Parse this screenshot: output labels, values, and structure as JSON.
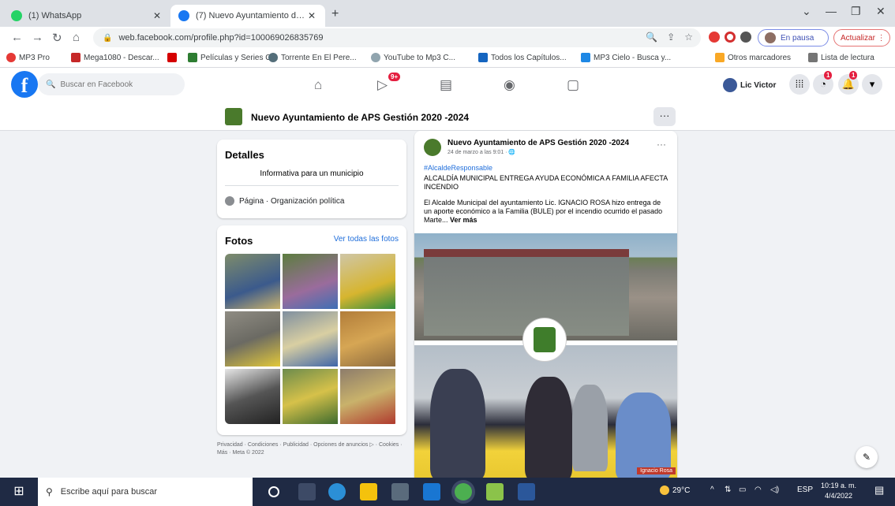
{
  "browser": {
    "tabs": [
      {
        "title": "(1) WhatsApp",
        "active": false
      },
      {
        "title": "(7) Nuevo Ayuntamiento de APS",
        "active": true
      }
    ],
    "address": "web.facebook.com/profile.php?id=100069026835769",
    "profile_pill": "En pausa",
    "update_pill": "Actualizar",
    "bookmarks": [
      "MP3 Pro",
      "Mega1080 - Descar...",
      "",
      "Películas y Series O...",
      "Torrente En El Pere...",
      "YouTube to Mp3 C...",
      "Todos los Capítulos...",
      "MP3 Cielo - Busca y...",
      "Otros marcadores",
      "Lista de lectura"
    ]
  },
  "fb": {
    "search_placeholder": "Buscar en Facebook",
    "video_badge": "9+",
    "user_name": "Lic Victor",
    "messenger_badge": "1",
    "notif_badge": "1"
  },
  "page": {
    "name": "Nuevo Ayuntamiento de APS Gestión 2020 -2024",
    "more": "···"
  },
  "details": {
    "title": "Detalles",
    "description": "Informativa para un municipio",
    "category": "Página · Organización política"
  },
  "photos": {
    "title": "Fotos",
    "see_all": "Ver todas las fotos"
  },
  "footer": "Privacidad · Condiciones · Publicidad · Opciones de anuncios ▷ · Cookies · Más · Meta © 2022",
  "post": {
    "author": "Nuevo Ayuntamiento de APS Gestión 2020 -2024",
    "time": "24 de marzo a las 9:01 · 🌐",
    "dots": "···",
    "hashtag": "#AlcaldeResponsable",
    "headline": "ALCALDÍA MUNICIPAL ENTREGA AYUDA ECONÓMICA A FAMILIA AFECTA INCENDIO",
    "body": "El Alcalde Municipal del ayuntamiento Lic. IGNACIO ROSA hizo entrega de un aporte económico a la Familia (BULE) por el incendio ocurrido el pasado Marte...",
    "see_more": "Ver más",
    "caption": "Ignacio Rosa"
  },
  "taskbar": {
    "search_placeholder": "Escribe aquí para buscar",
    "weather": "29°C",
    "lang": "ESP",
    "time": "10:19 a. m.",
    "date": "4/4/2022"
  }
}
